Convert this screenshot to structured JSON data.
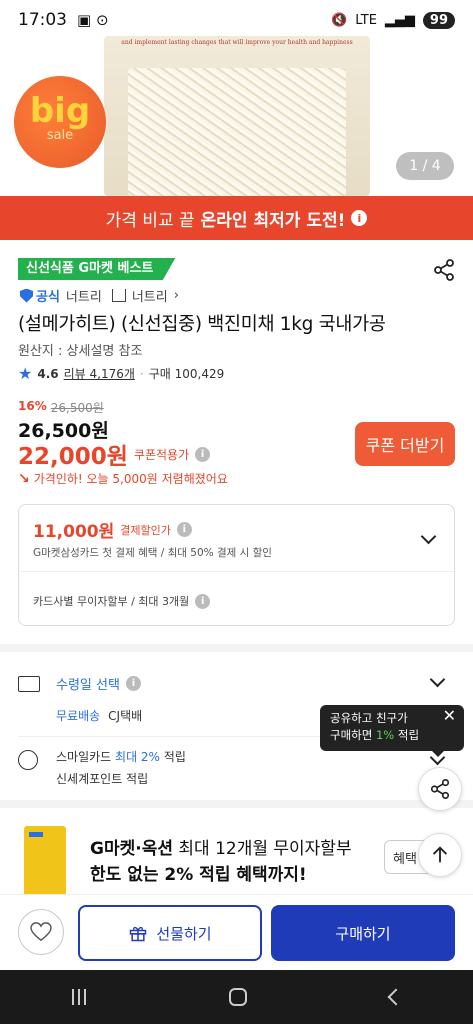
{
  "status_bar": {
    "time": "17:03",
    "network": "LTE",
    "battery": "99"
  },
  "hero": {
    "pack_text": "and implement lasting changes that will improve your health and happiness",
    "big_sale_big": "big",
    "big_sale_sale": "sale",
    "pager": "1 / 4"
  },
  "promo_banner": {
    "prefix": "가격 비교 끝",
    "highlight": "온라인 최저가 도전!",
    "info": "i"
  },
  "product": {
    "badge": "신선식품 G마켓 베스트",
    "official": "공식",
    "seller_small": "너트리",
    "store_name": "너트리",
    "store_chevron": "›",
    "title": "(설메가히트) (신선집중) 백진미채 1kg 국내가공",
    "origin": "원산지 : 상세설명 참조",
    "rating": "4.6",
    "reviews": "리뷰 4,176개",
    "purchases": "구매 100,429"
  },
  "price": {
    "discount_pct": "16%",
    "original": "26,500원",
    "main": "26,500원",
    "coupon_price": "22,000원",
    "coupon_label": "쿠폰적용가",
    "drop_text": "가격인하! 오늘 5,000원 저렴해졌어요",
    "coupon_button": "쿠폰 더받기"
  },
  "card_discount": {
    "price": "11,000원",
    "label": "결제할인가",
    "sub": "G마켓삼성카드 첫 결제 혜택 / 최대 50% 결제 시 할인",
    "installment": "카드사별 무이자할부 / 최대 3개월"
  },
  "delivery": {
    "title": "수령일 선택",
    "free": "무료배송",
    "carrier": "CJ택배"
  },
  "points": {
    "smile_prefix": "스마일카드",
    "smile_rate": "최대 2%",
    "smile_suffix": "적립",
    "shinsegae": "신세계포인트 적립"
  },
  "tooltip": {
    "line1": "공유하고 친구가",
    "line2_a": "구매하면",
    "line2_rate": "1%",
    "line2_b": "적립",
    "close": "✕"
  },
  "ad": {
    "line1_bold": "G마켓·옥션",
    "line1_rest": "최대 12개월 무이자할부",
    "line2": "한도 없는 2% 적립 혜택까지!",
    "button": "혜택"
  },
  "bottom": {
    "gift": "선물하기",
    "buy": "구매하기"
  },
  "colors": {
    "accent_red": "#e8462c",
    "brand_blue": "#1f3bb8",
    "badge_green": "#23b14d"
  },
  "icons": [
    "share-icon",
    "heart-icon",
    "gift-icon",
    "truck-icon",
    "coin-icon",
    "chevron-up-icon",
    "chevron-down-icon"
  ]
}
